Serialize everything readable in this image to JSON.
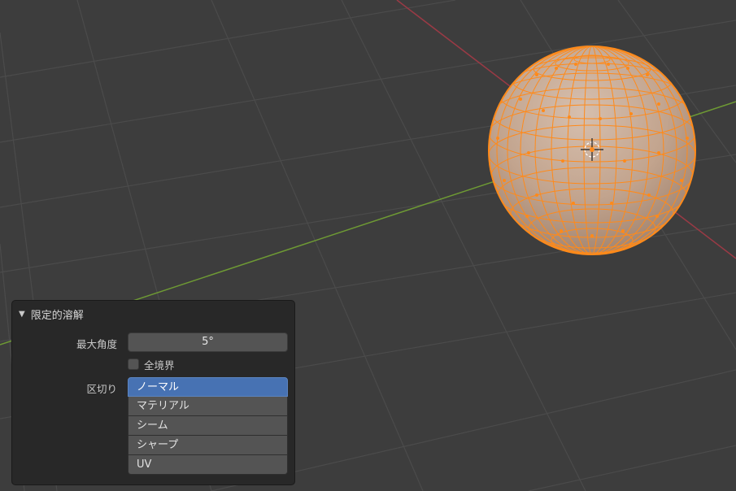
{
  "panel": {
    "title": "限定的溶解",
    "max_angle_label": "最大角度",
    "max_angle_value": "5°",
    "all_boundaries_label": "全境界",
    "all_boundaries_checked": false,
    "delimit_label": "区切り",
    "delimit_options": [
      {
        "label": "ノーマル",
        "selected": true
      },
      {
        "label": "マテリアル",
        "selected": false
      },
      {
        "label": "シーム",
        "selected": false
      },
      {
        "label": "シャープ",
        "selected": false
      },
      {
        "label": "UV",
        "selected": false
      }
    ]
  },
  "colors": {
    "viewport_bg": "#3d3d3d",
    "grid": "#4a4a4a",
    "x_axis": "#9a3a45",
    "y_axis": "#6e9a34",
    "selection": "#ff8a1a",
    "active": "#4772b3"
  }
}
